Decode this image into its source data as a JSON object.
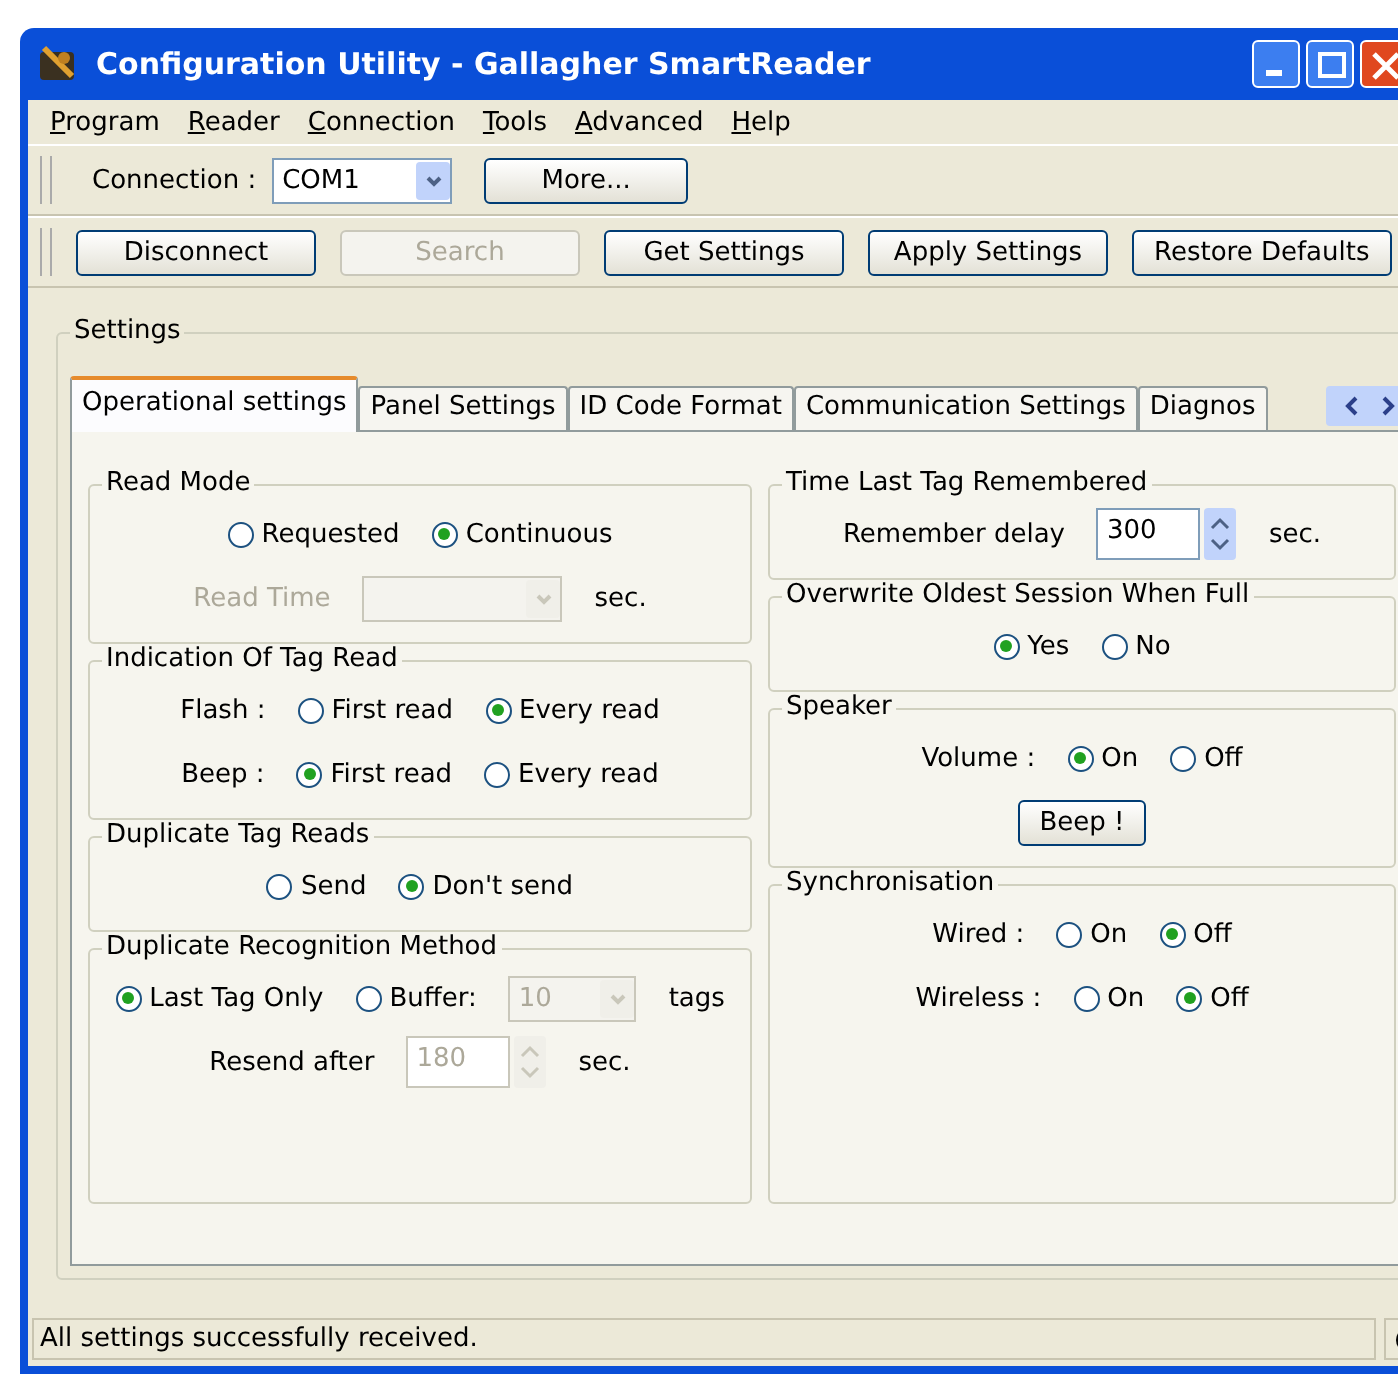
{
  "window": {
    "title": "Configuration Utility - Gallagher SmartReader"
  },
  "menu": [
    {
      "label": "Program"
    },
    {
      "label": "Reader"
    },
    {
      "label": "Connection"
    },
    {
      "label": "Tools"
    },
    {
      "label": "Advanced"
    },
    {
      "label": "Help"
    }
  ],
  "connection_bar": {
    "label": "Connection :",
    "value": "COM1",
    "button": "More..."
  },
  "action_bar": [
    {
      "label": "Disconnect",
      "disabled": false
    },
    {
      "label": "Search",
      "disabled": true
    },
    {
      "label": "Get Settings",
      "disabled": false
    },
    {
      "label": "Apply Settings",
      "disabled": false
    },
    {
      "label": "Restore Defaults",
      "disabled": false
    }
  ],
  "settings": {
    "title": "Settings",
    "tabs": [
      {
        "label": "Operational settings",
        "selected": true
      },
      {
        "label": "Panel Settings",
        "selected": false
      },
      {
        "label": "ID Code Format",
        "selected": false
      },
      {
        "label": "Communication Settings",
        "selected": false
      },
      {
        "label": "Diagnos",
        "selected": false
      }
    ],
    "left_groups": [
      {
        "title": "Read Mode",
        "rows": [
          {
            "items": [
              {
                "kind": "radio",
                "label": "Requested",
                "selected": false
              },
              {
                "kind": "radio",
                "label": "Continuous",
                "selected": true
              }
            ]
          },
          {
            "items": [
              {
                "kind": "label",
                "text": "Read Time",
                "disabled": true
              },
              {
                "kind": "combo",
                "disabled": true
              },
              {
                "kind": "label",
                "text": "sec.",
                "disabled": false
              }
            ]
          }
        ]
      },
      {
        "title": "Indication Of Tag Read",
        "rows": [
          {
            "items": [
              {
                "kind": "label",
                "text": "Flash :",
                "disabled": false
              },
              {
                "kind": "radio",
                "label": "First read",
                "selected": false
              },
              {
                "kind": "radio",
                "label": "Every read",
                "selected": true
              }
            ]
          },
          {
            "items": [
              {
                "kind": "label",
                "text": "Beep :",
                "disabled": false
              },
              {
                "kind": "radio",
                "label": "First read",
                "selected": true
              },
              {
                "kind": "radio",
                "label": "Every read",
                "selected": false
              }
            ]
          }
        ]
      },
      {
        "title": "Duplicate Tag Reads",
        "rows": [
          {
            "items": [
              {
                "kind": "radio",
                "label": "Send",
                "selected": false
              },
              {
                "kind": "radio",
                "label": "Don't send",
                "selected": true
              }
            ]
          }
        ]
      },
      {
        "title": "Duplicate Recognition Method",
        "rows": [
          {
            "items": [
              {
                "kind": "radio",
                "label": "Last Tag Only",
                "selected": true
              },
              {
                "kind": "radio",
                "label": "Buffer:",
                "selected": false
              },
              {
                "kind": "combo",
                "value": "10",
                "disabled": true
              },
              {
                "kind": "label",
                "text": "tags",
                "disabled": false
              }
            ]
          },
          {
            "items": [
              {
                "kind": "label",
                "text": "Resend after",
                "disabled": false
              },
              {
                "kind": "spin",
                "value": "180",
                "disabled": true
              },
              {
                "kind": "label",
                "text": "sec.",
                "disabled": false
              }
            ]
          }
        ]
      }
    ],
    "right_groups": [
      {
        "title": "Time Last Tag Remembered",
        "rows": [
          {
            "items": [
              {
                "kind": "label",
                "text": "Remember delay",
                "disabled": false
              },
              {
                "kind": "spin",
                "value": "300",
                "disabled": false
              },
              {
                "kind": "label",
                "text": "sec.",
                "disabled": false
              }
            ]
          }
        ]
      },
      {
        "title": "Overwrite Oldest Session When Full",
        "rows": [
          {
            "items": [
              {
                "kind": "radio",
                "label": "Yes",
                "selected": true
              },
              {
                "kind": "radio",
                "label": "No",
                "selected": false
              }
            ]
          }
        ]
      },
      {
        "title": "Speaker",
        "rows": [
          {
            "items": [
              {
                "kind": "label",
                "text": "Volume :",
                "disabled": false
              },
              {
                "kind": "radio",
                "label": "On",
                "selected": true
              },
              {
                "kind": "radio",
                "label": "Off",
                "selected": false
              }
            ]
          },
          {
            "items": [
              {
                "kind": "button",
                "label": "Beep !"
              }
            ]
          }
        ]
      },
      {
        "title": "Synchronisation",
        "rows": [
          {
            "items": [
              {
                "kind": "label",
                "text": "Wired :",
                "disabled": false
              },
              {
                "kind": "radio",
                "label": "On",
                "selected": false
              },
              {
                "kind": "radio",
                "label": "Off",
                "selected": true
              }
            ]
          },
          {
            "items": [
              {
                "kind": "label",
                "text": "Wireless :",
                "disabled": false
              },
              {
                "kind": "radio",
                "label": "On",
                "selected": false
              },
              {
                "kind": "radio",
                "label": "Off",
                "selected": true
              }
            ]
          }
        ]
      }
    ]
  },
  "status_bar": {
    "text": "All settings successfully received."
  }
}
